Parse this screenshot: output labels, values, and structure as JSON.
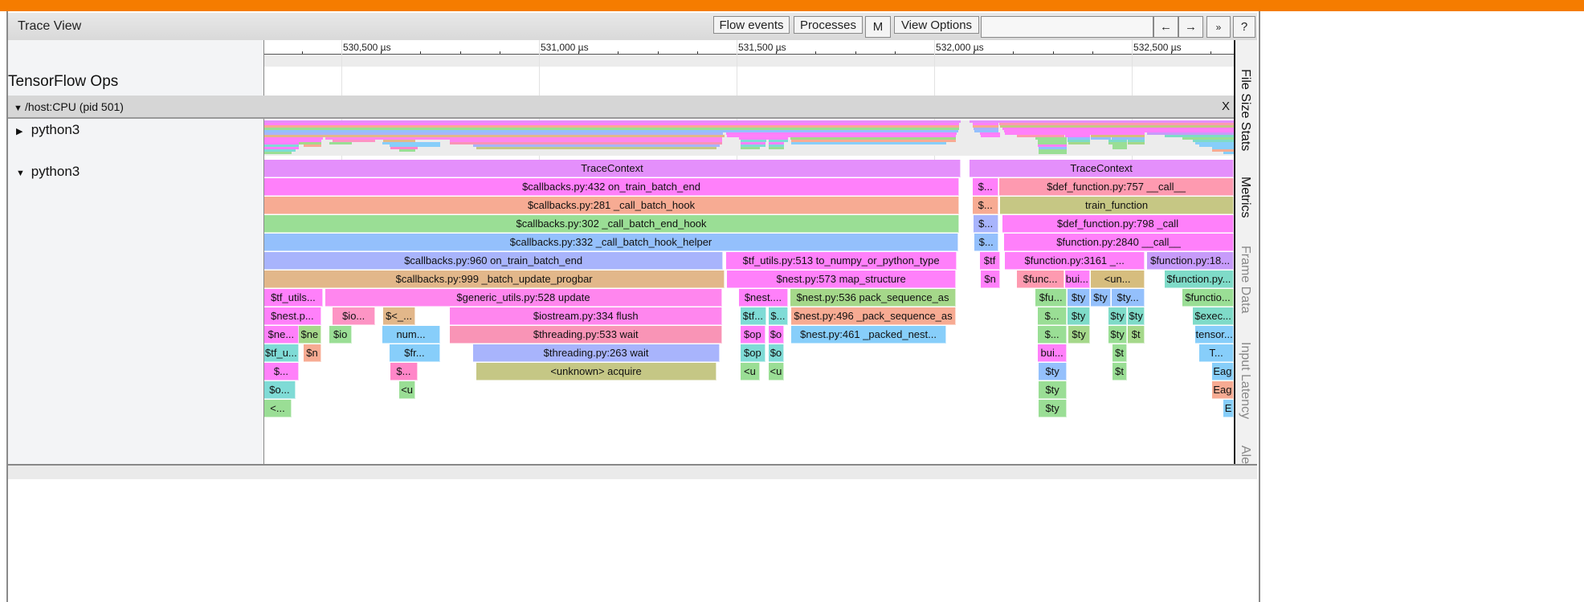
{
  "header": {
    "title": "Trace View",
    "buttons": {
      "flow_events": "Flow events",
      "processes": "Processes",
      "metadata": "M",
      "view_options": "View Options",
      "prev": "←",
      "next": "→",
      "more": "»",
      "help": "?"
    },
    "search_value": ""
  },
  "timeline": {
    "unit": "µs",
    "range_us": [
      530305,
      532758
    ],
    "major_ticks": [
      {
        "value": 530500,
        "label": "530,500 µs"
      },
      {
        "value": 531000,
        "label": "531,000 µs"
      },
      {
        "value": 531500,
        "label": "531,500 µs"
      },
      {
        "value": 532000,
        "label": "532,000 µs"
      },
      {
        "value": 532500,
        "label": "532,500 µs"
      }
    ],
    "minor_tick_interval_us": 100
  },
  "tracks": {
    "tensorflow_ops": "TensorFlow Ops",
    "process": {
      "label": "/host:CPU (pid 501)",
      "close": "X"
    },
    "thread_collapsed": "python3",
    "thread_expanded": "python3"
  },
  "colors": {
    "accent": "#f57c00"
  },
  "slices": [
    [
      0,
      530305,
      532067,
      "TraceContext",
      "#e48ffb"
    ],
    [
      0,
      532090,
      532758,
      "TraceContext",
      "#e48ffb"
    ],
    [
      1,
      530305,
      532063,
      "$callbacks.py:432 on_train_batch_end",
      "#ff80fa"
    ],
    [
      1,
      532098,
      532163,
      "$...",
      "#ff80fa"
    ],
    [
      1,
      532165,
      532758,
      "$def_function.py:757 __call__",
      "#fe9ab0"
    ],
    [
      2,
      530305,
      532063,
      "$callbacks.py:281 _call_batch_hook",
      "#f7ab93"
    ],
    [
      2,
      532098,
      532163,
      "$...",
      "#f7ab93"
    ],
    [
      2,
      532167,
      532758,
      "train_function",
      "#c6c784"
    ],
    [
      3,
      530305,
      532063,
      "$callbacks.py:302 _call_batch_end_hook",
      "#9ade95"
    ],
    [
      3,
      532100,
      532163,
      "$...",
      "#a8b4fc"
    ],
    [
      3,
      532173,
      532758,
      "$def_function.py:798 _call",
      "#ff80fa"
    ],
    [
      4,
      530305,
      532061,
      "$callbacks.py:332 _call_batch_hook_helper",
      "#94c0fc"
    ],
    [
      4,
      532102,
      532163,
      "$...",
      "#94c0fc"
    ],
    [
      4,
      532177,
      532758,
      "$function.py:2840 __call__",
      "#ff80fa"
    ],
    [
      5,
      530305,
      531466,
      "$callbacks.py:960 on_train_batch_end",
      "#a8b4fc"
    ],
    [
      5,
      531474,
      532057,
      "$tf_utils.py:513 to_numpy_or_python_type",
      "#ff80fa"
    ],
    [
      5,
      532116,
      532167,
      "$tf",
      "#ff80fa"
    ],
    [
      5,
      532179,
      532533,
      "$function.py:3161 _...",
      "#ff80fa"
    ],
    [
      5,
      532539,
      532758,
      "$function.py:18...",
      "#c79bfa"
    ],
    [
      6,
      530305,
      531470,
      "$callbacks.py:999 _batch_update_progbar",
      "#e2b78a"
    ],
    [
      6,
      531476,
      532055,
      "$nest.py:573 map_structure",
      "#ff80fa"
    ],
    [
      6,
      532118,
      532167,
      "$n",
      "#ff80fa"
    ],
    [
      6,
      532210,
      532329,
      "$func...",
      "#fe9ab0"
    ],
    [
      6,
      532331,
      532394,
      "bui...",
      "#ff80fa"
    ],
    [
      6,
      532396,
      532533,
      "<un...",
      "#d6bd7e"
    ],
    [
      6,
      532583,
      532758,
      "$function.py...",
      "#7fdbc8"
    ],
    [
      7,
      530305,
      530453,
      "$tf_utils...",
      "#ff80fa"
    ],
    [
      7,
      530459,
      531464,
      "$generic_utils.py:528 update",
      "#ff86ee"
    ],
    [
      7,
      531506,
      531630,
      "$nest....",
      "#ff80fa"
    ],
    [
      7,
      531636,
      532055,
      "$nest.py:536 pack_sequence_as",
      "#a5d88a"
    ],
    [
      7,
      532256,
      532336,
      "$fu...",
      "#9ade95"
    ],
    [
      7,
      532338,
      532394,
      "$ty",
      "#94c0fc"
    ],
    [
      7,
      532396,
      532447,
      "$ty",
      "#94c0fc"
    ],
    [
      7,
      532449,
      532533,
      "$ty...",
      "#94c0fc"
    ],
    [
      7,
      532628,
      532758,
      "$functio...",
      "#9ade95"
    ],
    [
      8,
      530305,
      530449,
      "$nest.p...",
      "#ff80fa"
    ],
    [
      8,
      530478,
      530586,
      "$io...",
      "#fd94c4"
    ],
    [
      8,
      530606,
      530687,
      "$<_...",
      "#e2b78a"
    ],
    [
      8,
      530775,
      531464,
      "$iostream.py:334 flush",
      "#ff86ee"
    ],
    [
      8,
      531510,
      531575,
      "$tf...",
      "#7fdbd6"
    ],
    [
      8,
      531581,
      531630,
      "$...",
      "#7fdbd6"
    ],
    [
      8,
      531638,
      532055,
      "$nest.py:496 _pack_sequence_as",
      "#f7ab93"
    ],
    [
      8,
      532262,
      532336,
      "$...",
      "#9ade95"
    ],
    [
      8,
      532338,
      532394,
      "$ty",
      "#7fdbc8"
    ],
    [
      8,
      532441,
      532488,
      "$ty",
      "#7fdbc8"
    ],
    [
      8,
      532490,
      532533,
      "$ty",
      "#7fdbc8"
    ],
    [
      8,
      532655,
      532758,
      "$exec...",
      "#7fdbc8"
    ],
    [
      9,
      530305,
      530392,
      "$ne...",
      "#ff80fa"
    ],
    [
      9,
      530392,
      530449,
      "$ne",
      "#a5d88a"
    ],
    [
      9,
      530470,
      530527,
      "$io",
      "#9ade95"
    ],
    [
      9,
      530604,
      530750,
      "num...",
      "#87cefa"
    ],
    [
      9,
      530775,
      531464,
      "$threading.py:533 wait",
      "#f994b6"
    ],
    [
      9,
      531510,
      531573,
      "$op",
      "#ff80fa"
    ],
    [
      9,
      531581,
      531620,
      "$o",
      "#ff80fa"
    ],
    [
      9,
      531638,
      532031,
      "$nest.py:461 _packed_nest...",
      "#87cefa"
    ],
    [
      9,
      532262,
      532336,
      "$...",
      "#9ade95"
    ],
    [
      9,
      532340,
      532394,
      "$ty",
      "#a5d88a"
    ],
    [
      9,
      532441,
      532488,
      "$ty",
      "#9ade95"
    ],
    [
      9,
      532490,
      532533,
      "$t",
      "#a5d88a"
    ],
    [
      9,
      532661,
      532758,
      "tensor...",
      "#87cefa"
    ],
    [
      10,
      530305,
      530392,
      "$tf_u...",
      "#7fdbd6"
    ],
    [
      10,
      530405,
      530449,
      "$n",
      "#f7ab93"
    ],
    [
      10,
      530622,
      530750,
      "$fr...",
      "#87cefa"
    ],
    [
      10,
      530834,
      531457,
      "$threading.py:263 wait",
      "#a8b4fc"
    ],
    [
      10,
      531510,
      531573,
      "$op",
      "#7fdbd6"
    ],
    [
      10,
      531581,
      531620,
      "$o",
      "#7fdbd6"
    ],
    [
      10,
      532262,
      532336,
      "bui...",
      "#ff80fa"
    ],
    [
      10,
      532451,
      532488,
      "$t",
      "#9ade95"
    ],
    [
      10,
      532671,
      532758,
      "T...",
      "#87cefa"
    ],
    [
      11,
      530305,
      530392,
      "$...",
      "#ff80fa"
    ],
    [
      11,
      530624,
      530693,
      "$...",
      "#ff86c8"
    ],
    [
      11,
      530842,
      531449,
      "<unknown> acquire",
      "#c5c785"
    ],
    [
      11,
      531510,
      531559,
      "<u",
      "#9ade95"
    ],
    [
      11,
      531581,
      531620,
      "<u",
      "#9ade95"
    ],
    [
      11,
      532264,
      532336,
      "$ty",
      "#94c0fc"
    ],
    [
      11,
      532451,
      532488,
      "$t",
      "#9ade95"
    ],
    [
      11,
      532703,
      532758,
      "Eag",
      "#87cefa"
    ],
    [
      12,
      530305,
      530384,
      "$o...",
      "#7fdbd6"
    ],
    [
      12,
      530647,
      530687,
      "<u",
      "#9ade95"
    ],
    [
      12,
      532264,
      532336,
      "$ty",
      "#9ade95"
    ],
    [
      12,
      532703,
      532758,
      "Eag",
      "#f7ab93"
    ],
    [
      13,
      530305,
      530374,
      "<...",
      "#9ade95"
    ],
    [
      13,
      532264,
      532336,
      "$ty",
      "#9ade95"
    ],
    [
      13,
      532732,
      532758,
      "E",
      "#87cefa"
    ]
  ],
  "sidebar": {
    "tabs": [
      {
        "label": "File Size Stats",
        "active": true
      },
      {
        "label": "Metrics",
        "active": true
      },
      {
        "label": "Frame Data",
        "active": false
      },
      {
        "label": "Input Latency",
        "active": false
      },
      {
        "label": "Alerts",
        "active": false
      }
    ]
  }
}
